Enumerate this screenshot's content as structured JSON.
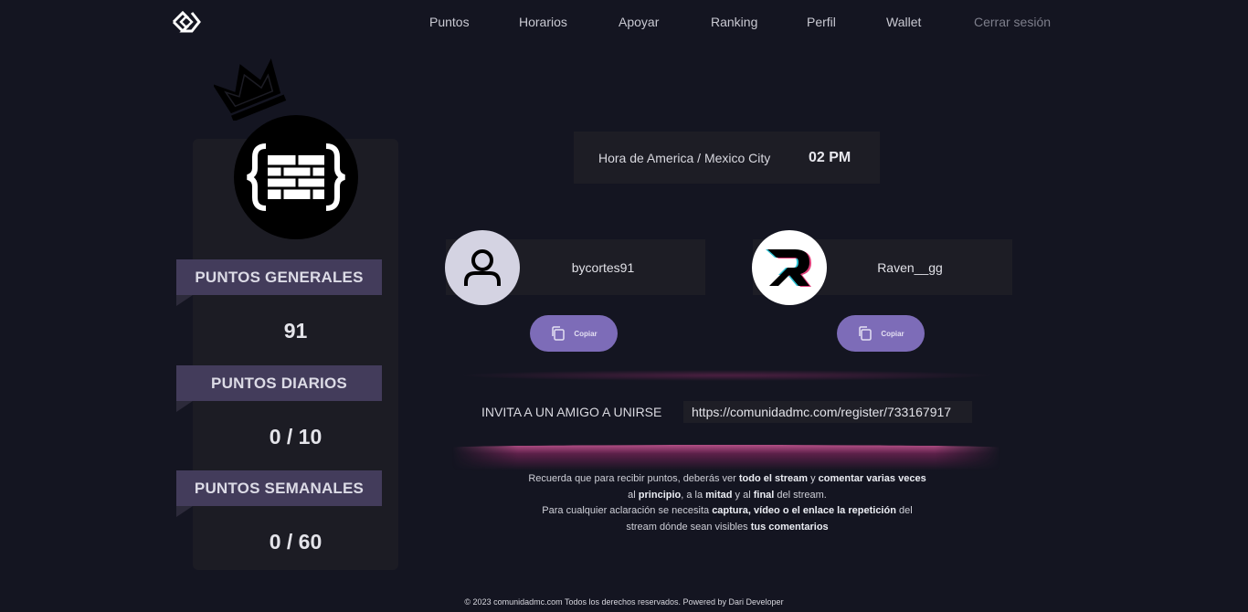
{
  "nav": {
    "items": [
      {
        "label": "Puntos"
      },
      {
        "label": "Horarios"
      },
      {
        "label": "Apoyar"
      },
      {
        "label": "Ranking"
      },
      {
        "label": "Perfil"
      },
      {
        "label": "Wallet"
      },
      {
        "label": "Cerrar sesión"
      }
    ]
  },
  "profile": {
    "icon": "brick-braces-icon",
    "points": [
      {
        "label": "PUNTOS GENERALES",
        "value": "91"
      },
      {
        "label": "PUNTOS DIARIOS",
        "value": "0 / 10"
      },
      {
        "label": "PUNTOS SEMANALES",
        "value": "0 / 60"
      }
    ]
  },
  "time": {
    "label": "Hora de America / Mexico City",
    "value": "02 PM"
  },
  "users": [
    {
      "name": "bycortes91",
      "avatar_icon": "user-outline-icon",
      "copy_label": "Copiar"
    },
    {
      "name": "Raven__gg",
      "avatar_icon": "raven-r-logo-icon",
      "copy_label": "Copiar"
    }
  ],
  "invite": {
    "label": "INVITA A UN AMIGO A UNIRSE",
    "link": "https://comunidadmc.com/register/733167917"
  },
  "notes": {
    "l1a": "Recuerda que para recibir puntos, deberás ver ",
    "l1b": "todo el stream",
    "l1c": " y ",
    "l1d": "comentar varias veces",
    "l2a": "al ",
    "l2b": "principio",
    "l2c": ", a la ",
    "l2d": "mitad",
    "l2e": " y al ",
    "l2f": "final",
    "l2g": " del stream.",
    "l3a": "Para cualquier aclaración se necesita ",
    "l3b": "captura, vídeo o el enlace la repetición",
    "l3c": " del",
    "l4a": "stream dónde sean visibles ",
    "l4b": "tus comentarios"
  },
  "footer": "© 2023 comunidadmc.com Todos los derechos reservados. Powered by Dari Developer",
  "colors": {
    "background": "#141521",
    "card": "#1c1c24",
    "label_bg": "#433c5b",
    "accent_button": "#7d6cb8",
    "glow": "#b34f86"
  }
}
